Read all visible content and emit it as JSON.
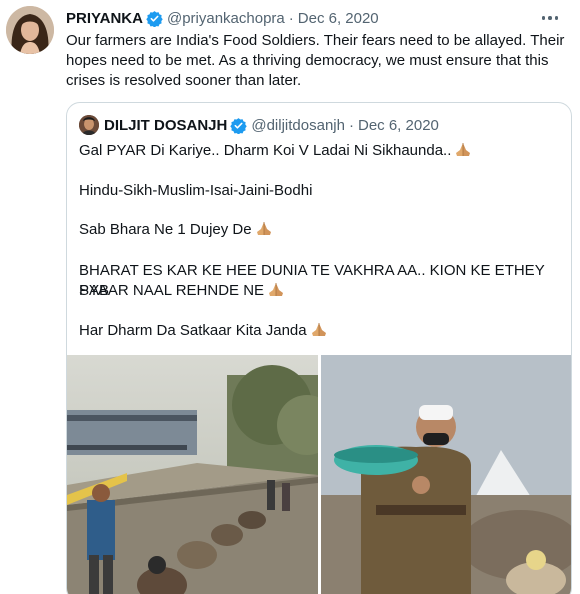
{
  "tweet": {
    "author_name": "PRIYANKA",
    "author_handle": "@priyankachopra",
    "separator": "·",
    "date": "Dec 6, 2020",
    "text": "Our farmers are India's Food Soldiers. Their fears need to be allayed. Their hopes need to be met. As a thriving democracy, we must ensure that this crises is resolved sooner than later."
  },
  "quoted": {
    "author_name": "DILJIT DOSANJH",
    "author_handle": "@diljitdosanjh",
    "separator": "·",
    "date": "Dec 6, 2020",
    "lines": [
      "Gal PYAR Di Kariye.. Dharm Koi V Ladai Ni Sikhaunda..",
      "Hindu-Sikh-Muslim-Isai-Jaini-Bodhi",
      "Sab Bhara Ne 1 Dujey De",
      "BHARAT ES KAR KE HEE DUNIA TE VAKHRA AA.. KION KE ETHEY SAB",
      "PYAAR NAAL REHNDE NE",
      "Har Dharm Da Satkaar Kita Janda"
    ]
  },
  "icons": {
    "verified": "verified-badge-icon",
    "more": "more-options-icon",
    "pray": "folded-hands-emoji"
  },
  "colors": {
    "verified_blue": "#1d9bf0",
    "muted_text": "#536471",
    "border": "#cfd9de"
  }
}
